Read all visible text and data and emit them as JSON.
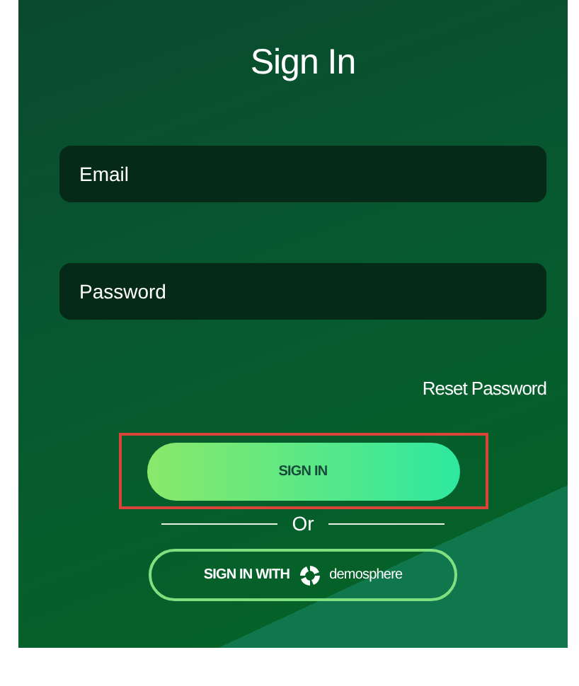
{
  "title": "Sign In",
  "fields": [
    {
      "placeholder": "Email"
    },
    {
      "placeholder": "Password"
    }
  ],
  "reset_link": "Reset Password",
  "sign_in_button": {
    "label": "SIGN IN",
    "highlighted": true
  },
  "divider_text": "Or",
  "sso_button": {
    "label": "SIGN IN WITH",
    "brand": "demosphere"
  }
}
